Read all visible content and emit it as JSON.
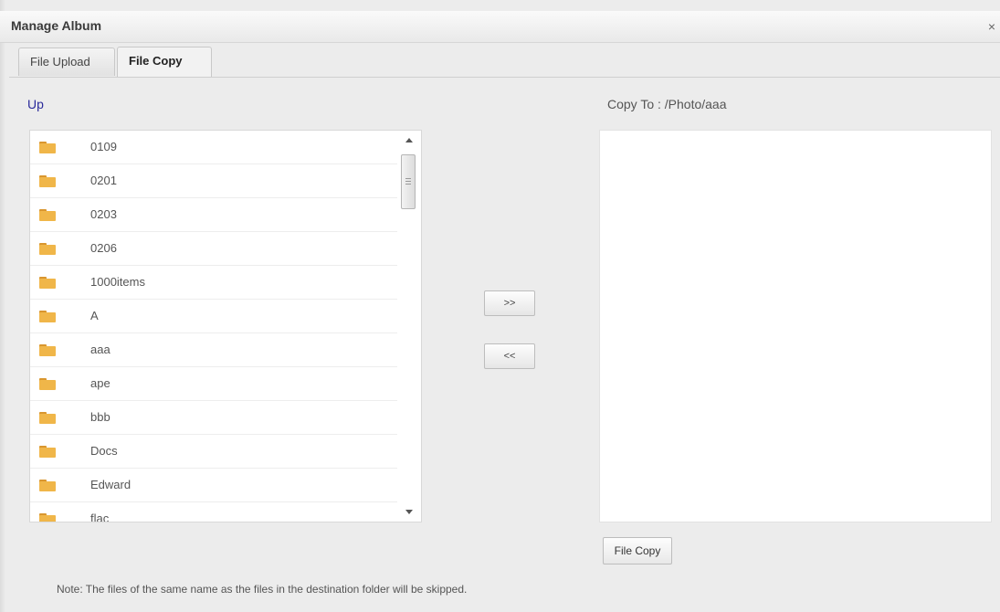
{
  "dialog": {
    "title": "Manage Album",
    "close_label": "×"
  },
  "tabs": [
    {
      "label": "File Upload",
      "active": false
    },
    {
      "label": "File Copy",
      "active": true
    }
  ],
  "nav": {
    "up_label": "Up",
    "copy_to_label": "Copy To : /Photo/aaa"
  },
  "source_list": {
    "items": [
      {
        "name": "0109",
        "icon": "folder-icon"
      },
      {
        "name": "0201",
        "icon": "folder-icon"
      },
      {
        "name": "0203",
        "icon": "folder-icon"
      },
      {
        "name": "0206",
        "icon": "folder-icon"
      },
      {
        "name": "1000items",
        "icon": "folder-icon"
      },
      {
        "name": "A",
        "icon": "folder-icon"
      },
      {
        "name": "aaa",
        "icon": "folder-icon"
      },
      {
        "name": "ape",
        "icon": "folder-icon"
      },
      {
        "name": "bbb",
        "icon": "folder-icon"
      },
      {
        "name": "Docs",
        "icon": "folder-icon"
      },
      {
        "name": "Edward",
        "icon": "folder-icon"
      },
      {
        "name": "flac",
        "icon": "folder-icon"
      }
    ]
  },
  "actions": {
    "add_label": ">>",
    "remove_label": "<<",
    "file_copy_label": "File Copy"
  },
  "note": "Note: The files of the same name as the files in the destination folder will be skipped.",
  "colors": {
    "folder": "#f0b649",
    "up_link": "#2b2b9b"
  }
}
